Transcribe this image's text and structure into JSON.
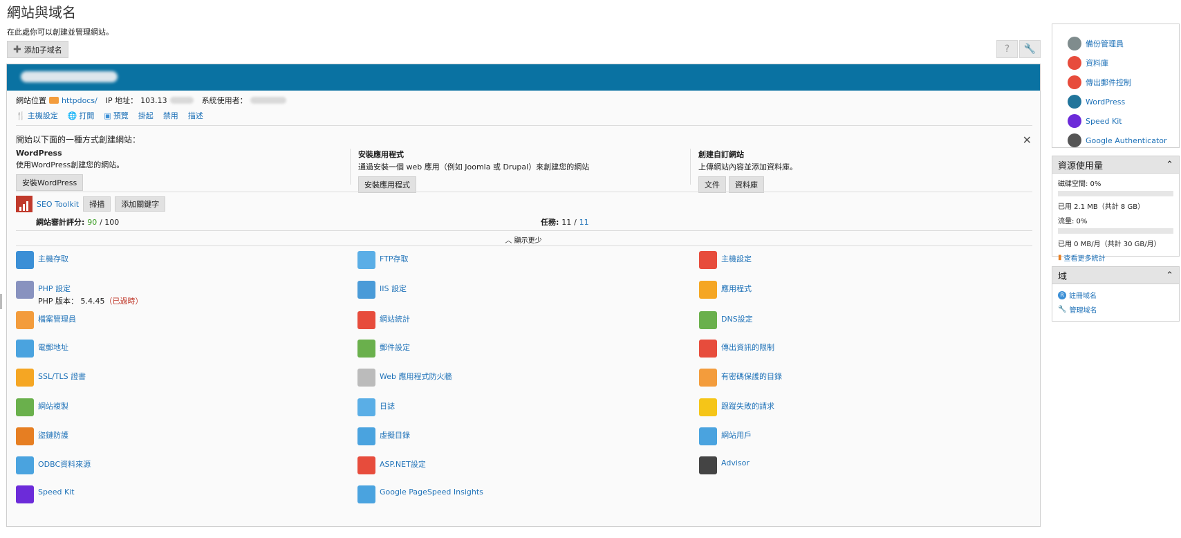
{
  "page": {
    "title": "網站與域名",
    "description": "在此處你可以創建並管理網站。",
    "add_subdomain_label": "添加子域名"
  },
  "domain_info": {
    "location_label": "網站位置",
    "location_value": "httpdocs/",
    "ip_label": "IP 地址：",
    "ip_value": "103.13",
    "user_label": "系統使用者："
  },
  "actions": [
    "主機設定",
    "打開",
    "預覽",
    "掛起",
    "禁用",
    "描述"
  ],
  "create_section": {
    "title": "開始以下面的一種方式創建網站：",
    "columns": [
      {
        "title": "WordPress",
        "desc": "使用WordPress創建您的網站。",
        "buttons": [
          "安裝WordPress"
        ]
      },
      {
        "title": "安裝應用程式",
        "desc": "通過安裝一個 web 應用（例如 Joomla 或 Drupal）來創建您的網站",
        "buttons": [
          "安裝應用程式"
        ]
      },
      {
        "title": "創建自訂網站",
        "desc": "上傳網站內容並添加資料庫。",
        "buttons": [
          "文件",
          "資料庫"
        ]
      }
    ]
  },
  "seo": {
    "name": "SEO Toolkit",
    "scan_label": "掃描",
    "add_keyword_label": "添加關鍵字",
    "score_label": "網站審計評分:",
    "score_value": "90",
    "score_max": "/ 100",
    "tasks_label": "任務:",
    "tasks_done": "11",
    "tasks_total": "11"
  },
  "show_less_label": "顯示更少",
  "tools": [
    {
      "label": "主機存取",
      "icon": "globe-flag-icon",
      "color": "#3b8fd6"
    },
    {
      "label": "FTP存取",
      "icon": "ftp-monitor-icon",
      "color": "#5aaee6"
    },
    {
      "label": "主機設定",
      "icon": "hosting-settings-icon",
      "color": "#e74c3c"
    },
    {
      "label": "PHP 設定",
      "icon": "php-icon",
      "color": "#8892bf",
      "sub_prefix": "PHP 版本： 5.4.45",
      "sub_warn": "（已過時）"
    },
    {
      "label": "IIS 設定",
      "icon": "iis-server-icon",
      "color": "#4a9bd8"
    },
    {
      "label": "應用程式",
      "icon": "gear-icon",
      "color": "#f5a623"
    },
    {
      "label": "檔案管理員",
      "icon": "folder-icon",
      "color": "#f39c3c"
    },
    {
      "label": "網站統計",
      "icon": "bar-chart-icon",
      "color": "#e74c3c"
    },
    {
      "label": "DNS設定",
      "icon": "dns-flags-icon",
      "color": "#6ab04c"
    },
    {
      "label": "電郵地址",
      "icon": "envelope-icon",
      "color": "#4aa3df"
    },
    {
      "label": "郵件設定",
      "icon": "mail-settings-icon",
      "color": "#6ab04c"
    },
    {
      "label": "傳出資訊的限制",
      "icon": "mail-limit-icon",
      "color": "#e74c3c"
    },
    {
      "label": "SSL/TLS 證書",
      "icon": "certificate-icon",
      "color": "#f5a623"
    },
    {
      "label": "Web 應用程式防火牆",
      "icon": "shield-icon",
      "color": "#bbbbbb"
    },
    {
      "label": "有密碼保護的目錄",
      "icon": "lock-folder-icon",
      "color": "#f39c3c"
    },
    {
      "label": "網站複製",
      "icon": "copy-icon",
      "color": "#6ab04c"
    },
    {
      "label": "日誌",
      "icon": "log-file-icon",
      "color": "#5aaee6"
    },
    {
      "label": "跟蹤失敗的請求",
      "icon": "failed-request-icon",
      "color": "#f5c518"
    },
    {
      "label": "盜鏈防護",
      "icon": "hotlink-shield-icon",
      "color": "#e67e22"
    },
    {
      "label": "虛擬目錄",
      "icon": "virtual-folder-icon",
      "color": "#4aa3df"
    },
    {
      "label": "網站用戶",
      "icon": "web-user-icon",
      "color": "#4aa3df"
    },
    {
      "label": "ODBC資料來源",
      "icon": "database-icon",
      "color": "#4aa3df"
    },
    {
      "label": "ASP.NET設定",
      "icon": "windows-icon",
      "color": "#e74c3c"
    },
    {
      "label": "Advisor",
      "icon": "owl-icon",
      "color": "#444444"
    },
    {
      "label": "Speed Kit",
      "icon": "rocket-icon",
      "color": "#6c2bd9"
    },
    {
      "label": "Google PageSpeed Insights",
      "icon": "speedometer-icon",
      "color": "#4aa3df"
    }
  ],
  "sidebar": {
    "links": [
      {
        "label": "備份管理員",
        "icon": "backup-icon",
        "color": "#7f8c8d"
      },
      {
        "label": "資料庫",
        "icon": "database-icon",
        "color": "#e74c3c"
      },
      {
        "label": "傳出郵件控制",
        "icon": "mail-limit-icon",
        "color": "#e74c3c"
      },
      {
        "label": "WordPress",
        "icon": "wordpress-icon",
        "color": "#21759b"
      },
      {
        "label": "Speed Kit",
        "icon": "rocket-icon",
        "color": "#6c2bd9"
      },
      {
        "label": "Google Authenticator",
        "icon": "authenticator-icon",
        "color": "#555555"
      }
    ],
    "resource": {
      "title": "資源使用量",
      "disk_label": "磁碟空間: 0%",
      "disk_fraction": 0,
      "disk_used": "已用 2.1 MB（共計 8 GB）",
      "traffic_label": "流量: 0%",
      "traffic_fraction": 0,
      "traffic_used": "已用 0 MB/月（共計 30 GB/月）",
      "more_stats_label": "查看更多統計"
    },
    "domains": {
      "title": "域",
      "register_label": "註冊域名",
      "manage_label": "管理域名"
    }
  }
}
